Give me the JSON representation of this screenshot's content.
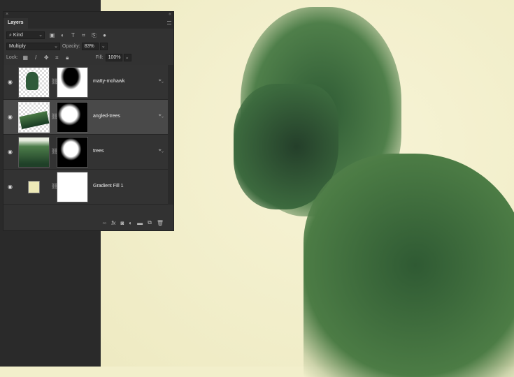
{
  "panel": {
    "close": "×",
    "collapse": "«",
    "tab": "Layers",
    "filter": {
      "label": "Kind",
      "icons": [
        "image-filter-icon",
        "adjustment-filter-icon",
        "type-filter-icon",
        "shape-filter-icon",
        "smart-object-filter-icon",
        "filter-toggle-icon"
      ]
    },
    "blend_mode": "Multiply",
    "opacity_label": "Opacity:",
    "opacity": "83%",
    "lock_label": "Lock:",
    "fill_label": "Fill:",
    "fill": "100%",
    "layers": [
      {
        "name": "matty-mohawk",
        "selected": false
      },
      {
        "name": "angled-trees",
        "selected": true
      },
      {
        "name": "trees",
        "selected": false
      },
      {
        "name": "Gradient Fill 1",
        "selected": false
      }
    ],
    "footer": [
      "link-icon",
      "fx-icon",
      "mask-icon",
      "adjustment-icon",
      "folder-icon",
      "new-layer-icon",
      "trash-icon"
    ]
  },
  "colors": {
    "canvas": "#f2efcb",
    "panel": "#323232",
    "selected": "#494949"
  }
}
